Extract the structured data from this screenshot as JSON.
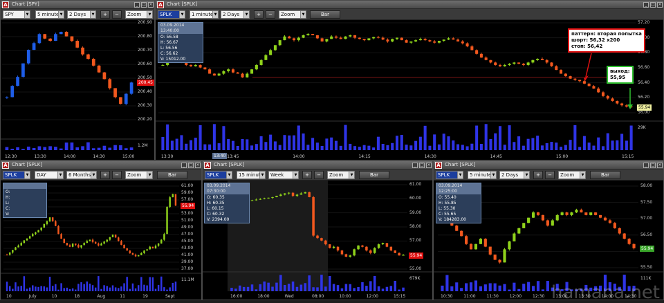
{
  "windows": [
    {
      "title": "Chart [SPY]",
      "symbol": "SPY",
      "interval": "5 minutes",
      "period": "2 Days",
      "zoom_label": "Zoom",
      "plus_label": "+",
      "minus_label": "−",
      "y_ticks": [
        "200.90",
        "200.80",
        "200.70",
        "200.60",
        "200.50",
        "200.40",
        "200.30",
        "200.20"
      ],
      "volume_label": "1.2M",
      "x_ticks": [
        "12:30",
        "13:30",
        "14:00",
        "14:30",
        "15:00"
      ],
      "price_tag": "200.45",
      "up_color": "#1e5de8",
      "down_color": "#f2581e",
      "chart_data": {
        "type": "candlestick",
        "title": "Chart [SPY]",
        "ylim": [
          200.12,
          200.98
        ],
        "close": [
          200.32,
          200.42,
          200.5,
          200.62,
          200.74,
          200.8,
          200.88,
          200.84,
          200.82,
          200.88,
          200.9,
          200.86,
          200.82,
          200.76,
          200.7,
          200.66,
          200.6,
          200.54,
          200.48,
          200.4,
          200.32,
          200.26,
          200.35,
          200.45
        ]
      }
    },
    {
      "title": "Chart [SPLK]",
      "symbol": "SPLK",
      "interval": "1 minute",
      "period": "2 Days",
      "zoom_label": "Zoom",
      "bar_label": "Bar",
      "plus_label": "+",
      "minus_label": "−",
      "y_ticks": [
        "57.20",
        "57.00",
        "56.80",
        "56.60",
        "56.40",
        "56.20",
        "56.00"
      ],
      "volume_label": "29K",
      "x_ticks": [
        "13:30",
        "13:45",
        "14:00",
        "14:15",
        "14:30",
        "14:45",
        "15:00",
        "15:15"
      ],
      "x_marker": "13:40",
      "price_tag": "55.94",
      "info": {
        "header": "03.09.2014 13:40:00",
        "o": "O: 56.58",
        "h": "H: 56.67",
        "l": "L: 56.56",
        "c": "C: 56.62",
        "v": "V: 15012.00"
      },
      "annotation_pattern": [
        "паттерн: вторая попытка",
        "шорт: 56,32 х200",
        "стоп: 56,42"
      ],
      "annotation_exit": [
        "выход:",
        "55,95"
      ],
      "up_color": "#8fd21b",
      "down_color": "#f2581e",
      "level_color": "#7a1414",
      "chart_data": {
        "type": "candlestick",
        "title": "Chart [SPLK]",
        "ylim": [
          55.85,
          57.3
        ],
        "close": [
          56.62,
          56.75,
          56.8,
          56.72,
          56.66,
          56.62,
          56.6,
          56.62,
          56.58,
          56.55,
          56.48,
          56.45,
          56.48,
          56.52,
          56.55,
          56.5,
          56.48,
          56.42,
          56.48,
          56.55,
          56.62,
          56.7,
          56.78,
          56.86,
          56.94,
          57.02,
          57.08,
          57.05,
          57.02,
          57.06,
          57.1,
          57.12,
          57.1,
          57.05,
          57.0,
          57.04,
          57.08,
          57.06,
          57.04,
          57.08,
          57.1,
          57.06,
          57.04,
          57.02,
          57.05,
          57.07,
          57.06,
          57.03,
          57.0,
          57.04,
          57.06,
          57.02,
          56.98,
          57.0,
          57.02,
          57.04,
          57.02,
          57.0,
          56.98,
          57.01,
          57.03,
          57.05,
          57.03,
          57.0,
          56.97,
          56.92,
          56.86,
          56.8,
          56.74,
          56.7,
          56.66,
          56.62,
          56.6,
          56.62,
          56.64,
          56.66,
          56.64,
          56.62,
          56.66,
          56.7,
          56.72,
          56.7,
          56.66,
          56.6,
          56.54,
          56.48,
          56.44,
          56.4,
          56.38,
          56.36,
          56.32,
          56.28,
          56.24,
          56.18,
          56.12,
          56.08,
          56.04,
          56.0,
          55.97,
          55.95,
          55.94
        ]
      }
    },
    {
      "title": "Chart [SPLK]",
      "symbol": "SPLK",
      "interval": "DAY",
      "period": "6 Months",
      "zoom_label": "Zoom",
      "bar_label": "Bar",
      "plus_label": "+",
      "minus_label": "−",
      "y_ticks": [
        "61.00",
        "59.00",
        "57.00",
        "55.00",
        "53.00",
        "51.00",
        "49.00",
        "47.00",
        "45.00",
        "43.00",
        "41.00",
        "39.00",
        "37.00"
      ],
      "volume_label": "11.1M",
      "x_ticks": [
        "10",
        "July",
        "10",
        "18",
        "Aug",
        "11",
        "19",
        "Sept"
      ],
      "price_tag": "55.94",
      "info": {
        "header": "",
        "o": "O:",
        "h": "H:",
        "l": "L:",
        "c": "C:",
        "v": "V:"
      },
      "up_color": "#8fd21b",
      "down_color": "#f2581e",
      "chart_data": {
        "type": "candlestick",
        "title": "Chart [SPLK]",
        "ylim": [
          36,
          62
        ],
        "close": [
          40.5,
          41.2,
          42.0,
          42.8,
          43.4,
          44.2,
          45.0,
          45.6,
          46.3,
          47.0,
          47.5,
          48.2,
          49.0,
          50.1,
          51.0,
          52.2,
          51.0,
          49.5,
          47.0,
          45.5,
          44.2,
          43.5,
          43.0,
          44.0,
          43.6,
          42.8,
          43.5,
          44.2,
          44.8,
          45.2,
          44.5,
          44.0,
          43.4,
          44.0,
          44.6,
          45.2,
          46.0,
          46.8,
          45.9,
          44.8,
          43.6,
          42.5,
          41.8,
          41.0,
          40.5,
          40.0,
          40.4,
          41.0,
          41.8,
          42.2,
          43.0,
          42.5,
          43.3,
          44.0,
          45.2,
          47.0,
          55.5,
          58.5,
          59.5,
          55.9
        ]
      }
    },
    {
      "title": "Chart [SPLK]",
      "symbol": "SPLK",
      "interval": "15 minutes",
      "period": "Week",
      "zoom_label": "Zoom",
      "bar_label": "Bar",
      "plus_label": "+",
      "minus_label": "−",
      "y_ticks": [
        "61.00",
        "60.00",
        "59.00",
        "58.00",
        "57.00",
        "56.00",
        "55.00"
      ],
      "volume_label": "679K",
      "x_ticks": [
        "16:00",
        "18:00",
        "Wed",
        "08:00",
        "10:00",
        "12:00",
        "15:15"
      ],
      "price_tag": "55.94",
      "info": {
        "header": "03.09.2014 07:30:00",
        "o": "O: 60.35",
        "h": "H: 60.35",
        "l": "L: 60.15",
        "c": "C: 60.32",
        "v": "V: 2394.00"
      },
      "up_color": "#8fd21b",
      "down_color": "#f2581e",
      "chart_data": {
        "type": "candlestick",
        "title": "Chart [SPLK]",
        "ylim": [
          54.8,
          61.6
        ],
        "close": [
          60.2,
          60.3,
          60.3,
          60.25,
          60.3,
          60.35,
          60.4,
          60.45,
          60.5,
          60.55,
          60.6,
          60.7,
          60.8,
          60.9,
          60.95,
          60.7,
          60.8,
          60.9,
          61.0,
          60.6,
          57.5,
          57.3,
          57.1,
          56.8,
          56.5,
          56.6,
          56.3,
          56.0,
          55.8,
          55.9,
          56.4,
          56.7,
          56.6,
          56.3,
          56.1,
          56.5,
          56.8,
          56.9,
          56.6,
          56.3,
          56.1,
          55.9,
          55.94
        ]
      }
    },
    {
      "title": "Chart [SPLK]",
      "symbol": "SPLK",
      "interval": "5 minutes",
      "period": "2 Days",
      "zoom_label": "Zoom",
      "bar_label": "Bar",
      "plus_label": "+",
      "minus_label": "−",
      "y_ticks": [
        "58.00",
        "57.50",
        "57.00",
        "56.50",
        "56.00",
        "55.50"
      ],
      "volume_label": "111K",
      "x_ticks": [
        "10:30",
        "11:00",
        "11:30",
        "12:00",
        "12:30",
        "13:00",
        "13:30",
        "14:00",
        "14:30"
      ],
      "price_tag": "55.94",
      "info": {
        "header": "03.09.2014 12:25:00",
        "o": "O: 55.40",
        "h": "H: 55.85",
        "l": "L: 55.30",
        "c": "C: 55.65",
        "v": "V: 184283.00"
      },
      "up_color": "#8fd21b",
      "down_color": "#f2581e",
      "chart_data": {
        "type": "candlestick",
        "title": "Chart [SPLK]",
        "ylim": [
          55.2,
          58.3
        ],
        "close": [
          57.3,
          57.0,
          56.8,
          56.6,
          56.4,
          56.1,
          55.9,
          56.1,
          56.3,
          56.0,
          55.7,
          55.5,
          55.4,
          55.9,
          56.2,
          56.5,
          56.7,
          56.9,
          57.1,
          57.3,
          57.2,
          57.0,
          56.8,
          57.0,
          57.2,
          57.3,
          57.2,
          57.3,
          57.4,
          57.3,
          57.2,
          57.3,
          57.2,
          57.1,
          57.0,
          56.9,
          56.7,
          56.5,
          56.3,
          56.1,
          55.94
        ]
      }
    }
  ],
  "watermark": "hamana.net"
}
